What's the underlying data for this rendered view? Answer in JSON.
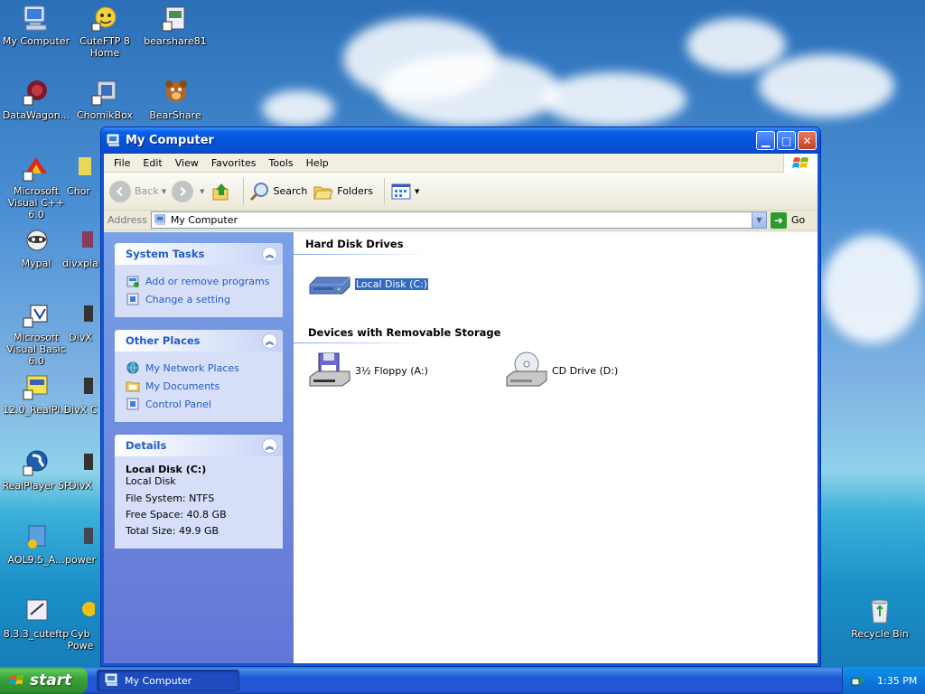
{
  "desktop": {
    "icons": [
      {
        "label": "My Computer"
      },
      {
        "label": "CuteFTP 8 Home"
      },
      {
        "label": "bearshare81"
      },
      {
        "label": "DataWagon..."
      },
      {
        "label": "ChomikBox"
      },
      {
        "label": "BearShare"
      },
      {
        "label": "Microsoft Visual C++ 6.0"
      },
      {
        "label": "Chor"
      },
      {
        "label": "Mypal"
      },
      {
        "label": "divxpla"
      },
      {
        "label": "Microsoft Visual Basic 6.0"
      },
      {
        "label": "DivX"
      },
      {
        "label": "12.0_RealPl..."
      },
      {
        "label": "DivX C"
      },
      {
        "label": "RealPlayer SP"
      },
      {
        "label": "DivX"
      },
      {
        "label": "AOL9.5_A..."
      },
      {
        "label": "power"
      },
      {
        "label": "8.3.3_cuteftp"
      },
      {
        "label": "Cyb Powe"
      },
      {
        "label": "Recycle Bin"
      }
    ]
  },
  "window": {
    "title": "My Computer",
    "menu": [
      "File",
      "Edit",
      "View",
      "Favorites",
      "Tools",
      "Help"
    ],
    "toolbar": {
      "back": "Back",
      "search": "Search",
      "folders": "Folders"
    },
    "address": {
      "label": "Address",
      "value": "My Computer",
      "go": "Go"
    },
    "taskpane": {
      "system_tasks": {
        "title": "System Tasks",
        "items": [
          "Add or remove programs",
          "Change a setting"
        ]
      },
      "other_places": {
        "title": "Other Places",
        "items": [
          "My Network Places",
          "My Documents",
          "Control Panel"
        ]
      },
      "details": {
        "title": "Details",
        "name": "Local Disk (C:)",
        "type": "Local Disk",
        "file_system": "File System: NTFS",
        "free_space": "Free Space: 40.8 GB",
        "total_size": "Total Size: 49.9 GB"
      }
    },
    "groups": {
      "hard_disk": {
        "title": "Hard Disk Drives",
        "items": [
          "Local Disk (C:)"
        ]
      },
      "removable": {
        "title": "Devices with Removable Storage",
        "items": [
          "3½ Floppy (A:)",
          "CD Drive (D:)"
        ]
      }
    }
  },
  "taskbar": {
    "start": "start",
    "task": "My Computer",
    "clock": "1:35 PM"
  },
  "colors": {
    "title_blue": "#0453d9",
    "link_blue": "#215dc6",
    "selection": "#316ac5",
    "start_green": "#37a237"
  }
}
